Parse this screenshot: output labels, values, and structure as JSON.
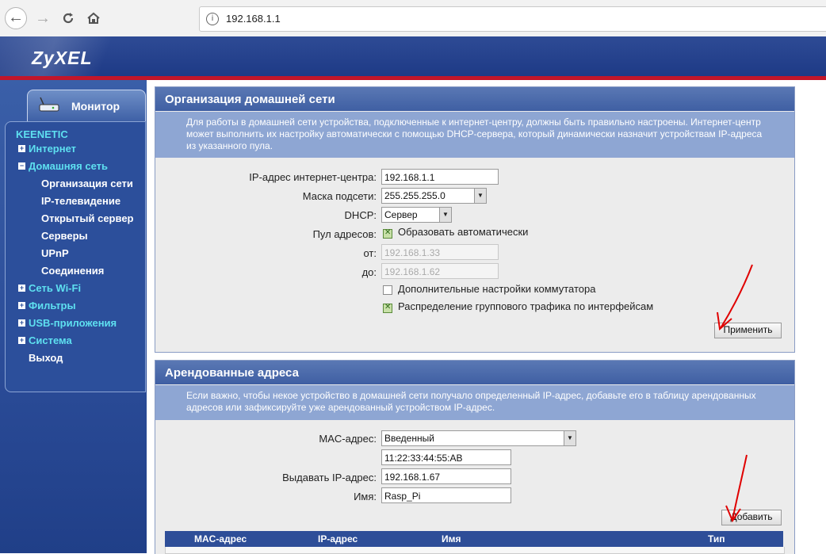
{
  "browser": {
    "url": "192.168.1.1"
  },
  "header": {
    "logo": "ZyXEL"
  },
  "sidebar": {
    "monitor_tab": "Монитор",
    "brand": "KEENETIC",
    "items": [
      {
        "label": "Интернет",
        "expanded": false
      },
      {
        "label": "Домашняя сеть",
        "expanded": true
      },
      {
        "label": "Сеть Wi-Fi",
        "expanded": false
      },
      {
        "label": "Фильтры",
        "expanded": false
      },
      {
        "label": "USB-приложения",
        "expanded": false
      },
      {
        "label": "Система",
        "expanded": false
      }
    ],
    "subitems": [
      "Организация сети",
      "IP-телевидение",
      "Открытый сервер",
      "Серверы",
      "UPnP",
      "Соединения"
    ],
    "logout": "Выход"
  },
  "network_panel": {
    "title": "Организация домашней сети",
    "description": "Для работы в домашней сети устройства, подключенные к интернет-центру, должны быть правильно настроены. Интернет-центр может выполнить их настройку автоматически с помощью DHCP-сервера, который динамически назначит устройствам IP-адреса из указанного пула.",
    "ip_label": "IP-адрес интернет-центра:",
    "ip_value": "192.168.1.1",
    "mask_label": "Маска подсети:",
    "mask_value": "255.255.255.0",
    "dhcp_label": "DHCP:",
    "dhcp_value": "Сервер",
    "pool_label": "Пул адресов:",
    "pool_auto_label": "Образовать автоматически",
    "pool_auto_checked": true,
    "from_label": "от:",
    "from_value": "192.168.1.33",
    "to_label": "до:",
    "to_value": "192.168.1.62",
    "switch_label": "Дополнительные настройки коммутатора",
    "switch_checked": false,
    "multicast_label": "Распределение группового трафика по интерфейсам",
    "multicast_checked": true,
    "apply_button": "Применить"
  },
  "lease_panel": {
    "title": "Арендованные адреса",
    "description": "Если важно, чтобы некое устройство в домашней сети получало определенный IP-адрес, добавьте его в таблицу арендованных адресов или зафиксируйте уже арендованный устройством IP-адрес.",
    "mac_label": "MAC-адрес:",
    "mac_select_value": "Введенный",
    "mac_value": "11:22:33:44:55:AB",
    "ip_label": "Выдавать IP-адрес:",
    "ip_value": "192.168.1.67",
    "name_label": "Имя:",
    "name_value": "Rasp_Pi",
    "add_button": "Добавить",
    "table_headers": [
      "MAC-адрес",
      "IP-адрес",
      "Имя",
      "Тип"
    ]
  },
  "colors": {
    "header_blue": "#1e3a86",
    "accent_red": "#c2162a",
    "menu_cyan": "#5ee0f0",
    "annotation_arrow": "#e00000"
  }
}
